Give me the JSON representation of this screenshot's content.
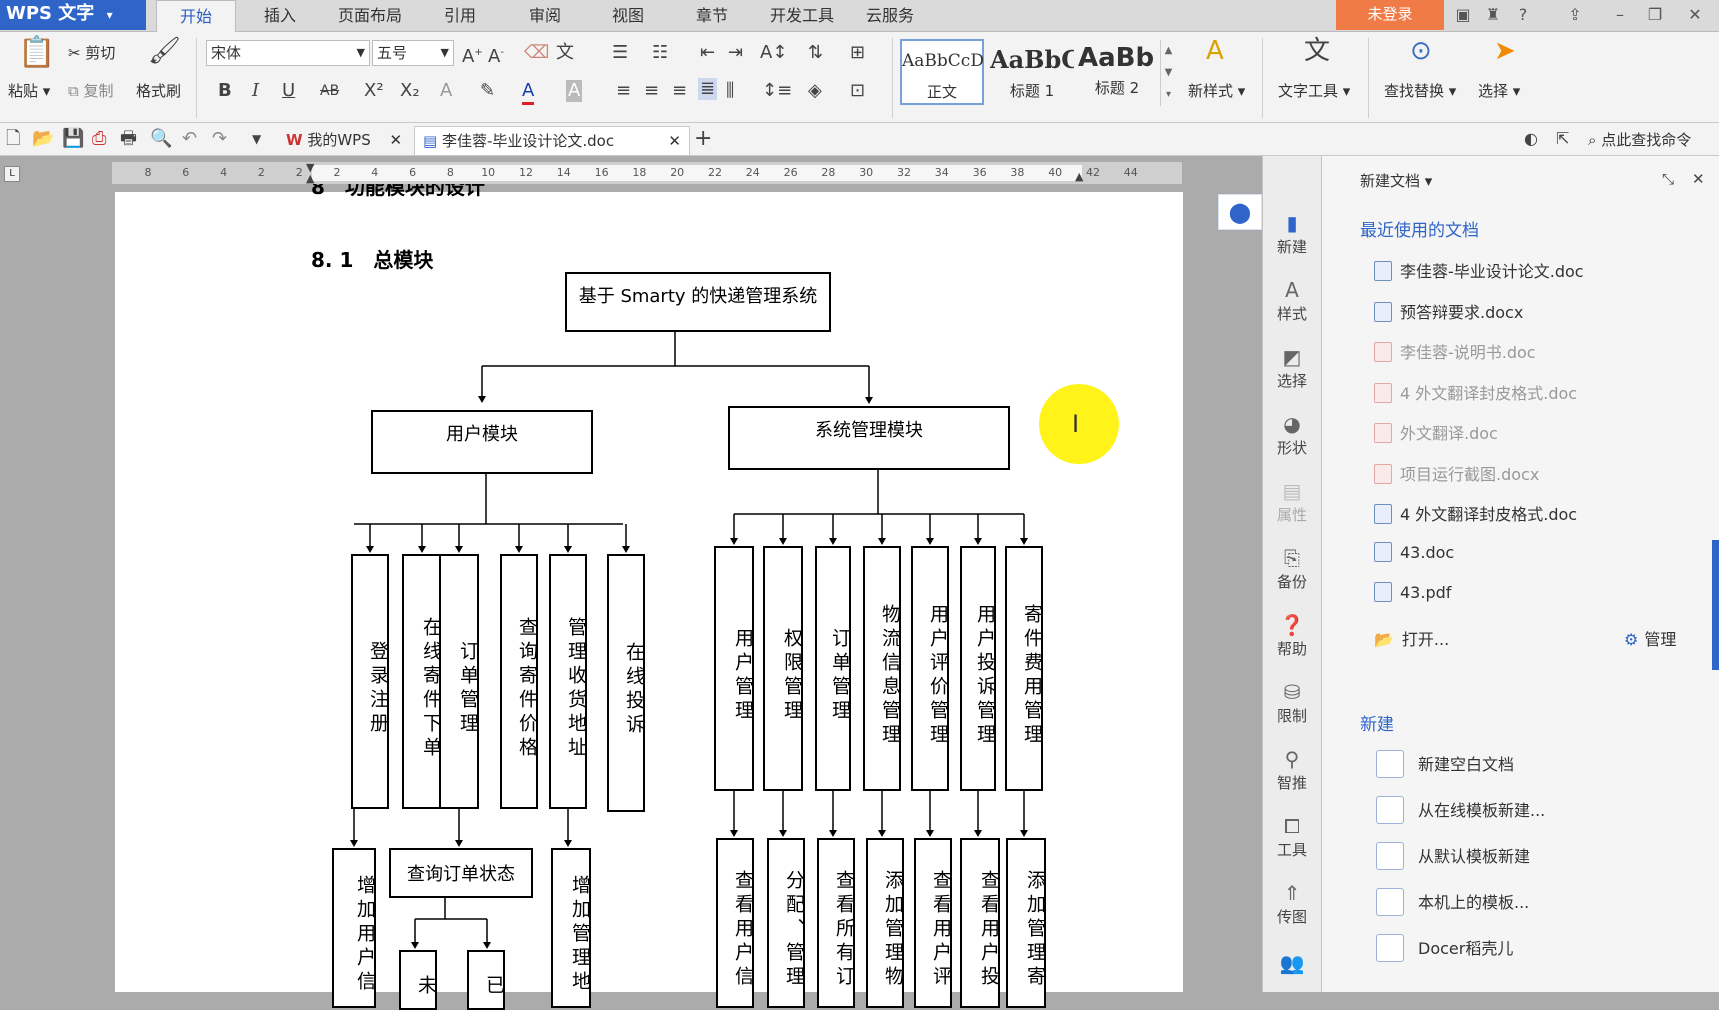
{
  "app": {
    "title": "WPS 文字",
    "login": "未登录"
  },
  "menu_tabs": [
    "开始",
    "插入",
    "页面布局",
    "引用",
    "审阅",
    "视图",
    "章节",
    "开发工具",
    "云服务"
  ],
  "ribbon": {
    "paste": "粘贴",
    "cut": "剪切",
    "copy": "复制",
    "format_painter": "格式刷",
    "font_name": "宋体",
    "font_size": "五号",
    "styles": [
      {
        "preview": "AaBbCcD",
        "name": "正文"
      },
      {
        "preview": "AaBbC",
        "name": "标题 1"
      },
      {
        "preview": "AaBb(",
        "name": "标题 2"
      }
    ],
    "new_style": "新样式",
    "text_tool": "文字工具",
    "find_replace": "查找替换",
    "select": "选择"
  },
  "doc_tabs": [
    {
      "label": "我的WPS"
    },
    {
      "label": "李佳蓉-毕业设计论文.doc"
    }
  ],
  "search_cmd": "点此查找命令",
  "ruler_numbers": [
    "8",
    "6",
    "4",
    "2",
    "2",
    "2",
    "4",
    "6",
    "8",
    "10",
    "12",
    "14",
    "16",
    "18",
    "20",
    "22",
    "24",
    "26",
    "28",
    "30",
    "32",
    "34",
    "36",
    "38",
    "40",
    "42",
    "44"
  ],
  "document": {
    "partial_heading": "8　功能模块的设计",
    "heading": "8. 1　总模块",
    "diagram": {
      "root": "基于 Smarty 的快递管理系统",
      "user_module": "用户模块",
      "sys_module": "系统管理模块",
      "user_children": [
        "登录注册",
        "在线寄件下单",
        "订单管理",
        "查询寄件价格",
        "管理收货地址",
        "在线投诉"
      ],
      "sys_children": [
        "用户管理",
        "权限管理",
        "订单管理",
        "物流信息管理",
        "用户评价管理",
        "用户投诉管理",
        "寄件费用管理"
      ],
      "user_sub": [
        "增加用户信",
        "查询订单状态",
        "增加管理地"
      ],
      "order_sub": [
        "未",
        "已"
      ],
      "sys_sub": [
        "查看用户信",
        "分配、管理",
        "查看所有订",
        "添加管理物",
        "查看用户评",
        "查看用户投",
        "添加管理寄"
      ]
    }
  },
  "rail": [
    "新建",
    "样式",
    "选择",
    "形状",
    "属性",
    "备份",
    "帮助",
    "限制",
    "智推",
    "工具",
    "传图"
  ],
  "panel": {
    "header": "新建文档",
    "recent_title": "最近使用的文档",
    "recent": [
      {
        "name": "李佳蓉-毕业设计论文.doc",
        "dim": false
      },
      {
        "name": "预答辩要求.docx",
        "dim": false
      },
      {
        "name": "李佳蓉-说明书.doc",
        "dim": true
      },
      {
        "name": "4 外文翻译封皮格式.doc",
        "dim": true
      },
      {
        "name": "外文翻译.doc",
        "dim": true
      },
      {
        "name": "项目运行截图.docx",
        "dim": true
      },
      {
        "name": "4 外文翻译封皮格式.doc",
        "dim": false
      },
      {
        "name": "43.doc",
        "dim": false
      },
      {
        "name": "43.pdf",
        "dim": false
      }
    ],
    "open": "打开...",
    "manage": "管理",
    "new_title": "新建",
    "new_items": [
      "新建空白文档",
      "从在线模板新建...",
      "从默认模板新建",
      "本机上的模板...",
      "Docer稻壳儿"
    ]
  }
}
